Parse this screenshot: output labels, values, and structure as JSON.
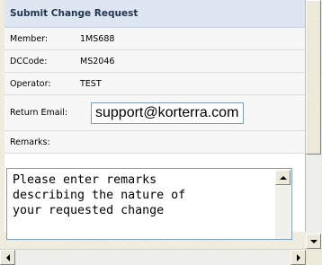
{
  "form": {
    "title": "Submit Change Request",
    "fields": [
      {
        "label": "Member:",
        "value": "1MS688"
      },
      {
        "label": "DCCode:",
        "value": "MS2046"
      },
      {
        "label": "Operator:",
        "value": "TEST"
      }
    ],
    "email": {
      "label": "Return Email:",
      "value": "support@korterra.com"
    },
    "remarks": {
      "label": "Remarks:",
      "text": "Please enter remarks\ndescribing the nature of\nyour requested change"
    }
  },
  "icons": [
    "arrow-up-icon",
    "arrow-down-icon",
    "arrow-left-icon",
    "arrow-right-icon"
  ]
}
